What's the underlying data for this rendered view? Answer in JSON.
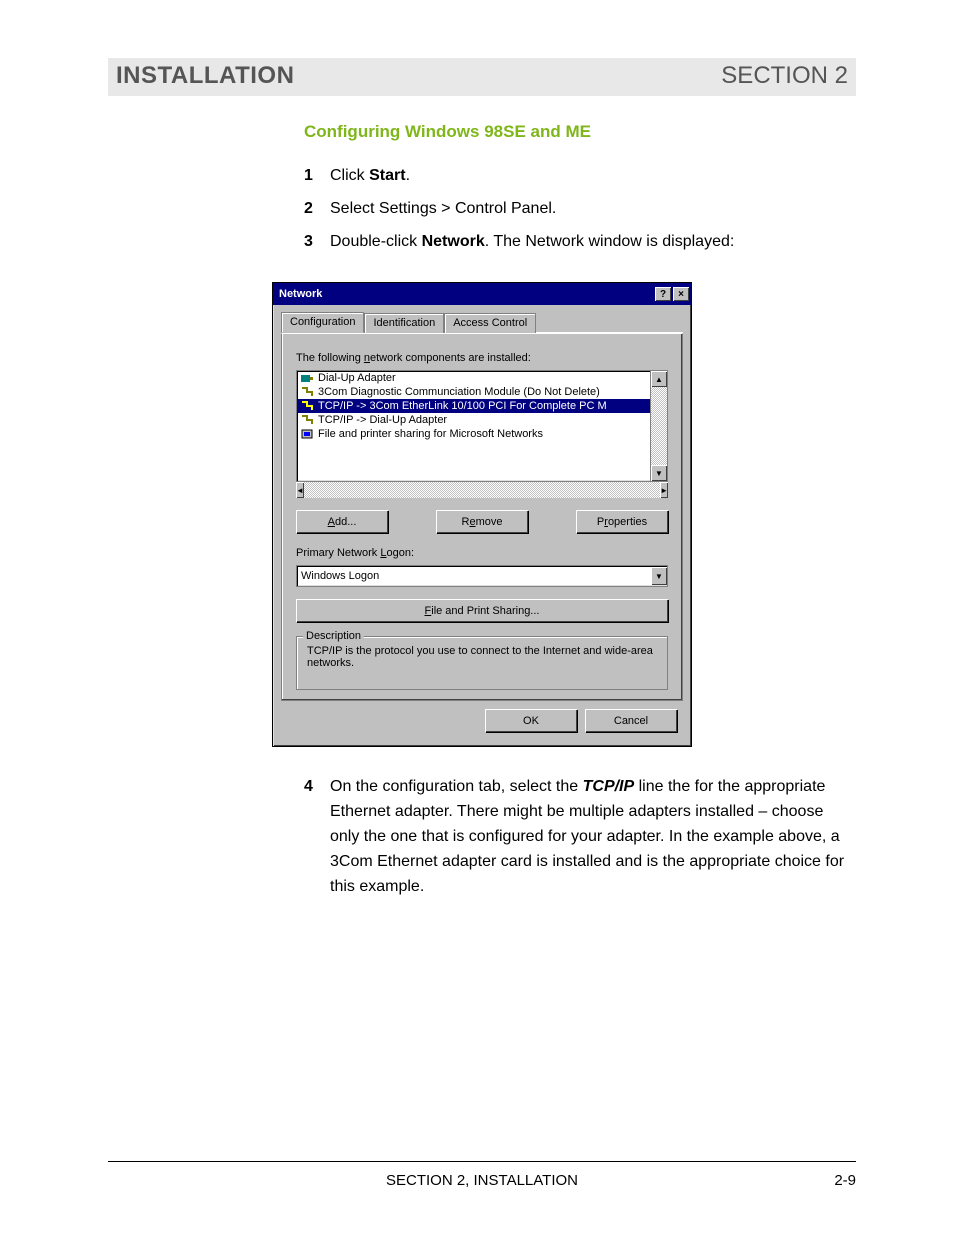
{
  "header": {
    "left": "INSTALLATION",
    "right": "SECTION 2"
  },
  "subheading": "Configuring Windows 98SE and ME",
  "steps": {
    "s1_a": "Click ",
    "s1_b": "Start",
    "s1_c": ".",
    "s2": "Select Settings > Control Panel.",
    "s3_a": "Double-click ",
    "s3_b": "Network",
    "s3_c": ". The Network window is displayed:",
    "s4_a": "On the configuration tab, select the ",
    "s4_b": "TCP/IP",
    "s4_c": " line the for the appropriate Ethernet adapter. There might be multiple adapters installed – choose only the one that is configured for your adapter. In the example above, a 3Com Ethernet adapter card is installed and is the appropriate choice for this example."
  },
  "dialog": {
    "title": "Network",
    "tabs": [
      "Configuration",
      "Identification",
      "Access Control"
    ],
    "list_label": "The following network components are installed:",
    "components": [
      "Dial-Up Adapter",
      "3Com Diagnostic Communciation Module (Do Not Delete)",
      "TCP/IP -> 3Com EtherLink 10/100 PCI For Complete PC M",
      "TCP/IP -> Dial-Up Adapter",
      "File and printer sharing for Microsoft Networks"
    ],
    "buttons": {
      "add": "Add...",
      "remove": "Remove",
      "properties": "Properties"
    },
    "logon_label": "Primary Network Logon:",
    "logon_value": "Windows Logon",
    "fps": "File and Print Sharing...",
    "group_title": "Description",
    "group_text": "TCP/IP is the protocol you use to connect to the Internet and wide-area networks.",
    "ok": "OK",
    "cancel": "Cancel",
    "help": "?",
    "close": "×"
  },
  "footer": {
    "center": "SECTION 2, INSTALLATION",
    "page": "2-9"
  }
}
